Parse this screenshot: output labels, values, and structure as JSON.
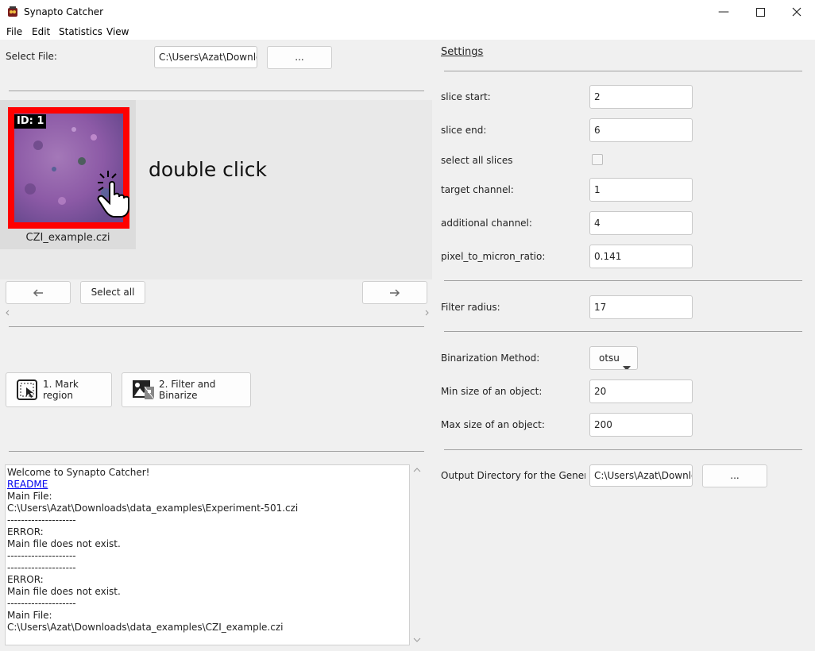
{
  "window": {
    "title": "Synapto Catcher",
    "minimize_icon": "minimize-icon",
    "maximize_icon": "maximize-icon",
    "close_icon": "close-icon"
  },
  "menu": [
    "File",
    "Edit",
    "Statistics",
    "View"
  ],
  "file_select": {
    "label": "Select File:",
    "path": "C:\\Users\\Azat\\Downloads",
    "browse_label": "..."
  },
  "gallery": {
    "id_badge": "ID: 1",
    "filename": "CZI_example.czi",
    "hint": "double click",
    "selected_border_color": "#ff0000",
    "prev_icon": "arrow-left-icon",
    "next_icon": "arrow-right-icon",
    "select_all_label": "Select all"
  },
  "actions": {
    "mark_region_label": "1. Mark region",
    "filter_binarize_label": "2. Filter and Binarize"
  },
  "log": {
    "lines": [
      {
        "text": "Welcome to Synapto Catcher!",
        "link": false
      },
      {
        "text": "README",
        "link": true
      },
      {
        "text": "Main File:",
        "link": false
      },
      {
        "text": "C:\\Users\\Azat\\Downloads\\data_examples\\Experiment-501.czi",
        "link": false
      },
      {
        "text": "--------------------",
        "link": false
      },
      {
        "text": "ERROR:",
        "link": false
      },
      {
        "text": "Main file does not exist.",
        "link": false
      },
      {
        "text": "--------------------",
        "link": false
      },
      {
        "text": "--------------------",
        "link": false
      },
      {
        "text": "ERROR:",
        "link": false
      },
      {
        "text": "Main file does not exist.",
        "link": false
      },
      {
        "text": "--------------------",
        "link": false
      },
      {
        "text": "Main File:",
        "link": false
      },
      {
        "text": "C:\\Users\\Azat\\Downloads\\data_examples\\CZI_example.czi",
        "link": false
      }
    ]
  },
  "settings": {
    "heading": "Settings",
    "slice_start_label": "slice start:",
    "slice_start": "2",
    "slice_end_label": "slice end:",
    "slice_end": "6",
    "select_all_slices_label": "select all slices",
    "target_channel_label": "target channel:",
    "target_channel": "1",
    "additional_channel_label": "additional channel:",
    "additional_channel": "4",
    "pixel_ratio_label": "pixel_to_micron_ratio:",
    "pixel_ratio": "0.141",
    "filter_radius_label": "Filter radius:",
    "filter_radius": "17",
    "binarization_label": "Binarization Method:",
    "binarization": "otsu",
    "min_size_label": "Min size of an object:",
    "min_size": "20",
    "max_size_label": "Max size of an object:",
    "max_size": "200",
    "output_dir_label": "Output Directory for the General a",
    "output_dir": "C:\\Users\\Azat\\Downloads",
    "output_browse_label": "..."
  }
}
